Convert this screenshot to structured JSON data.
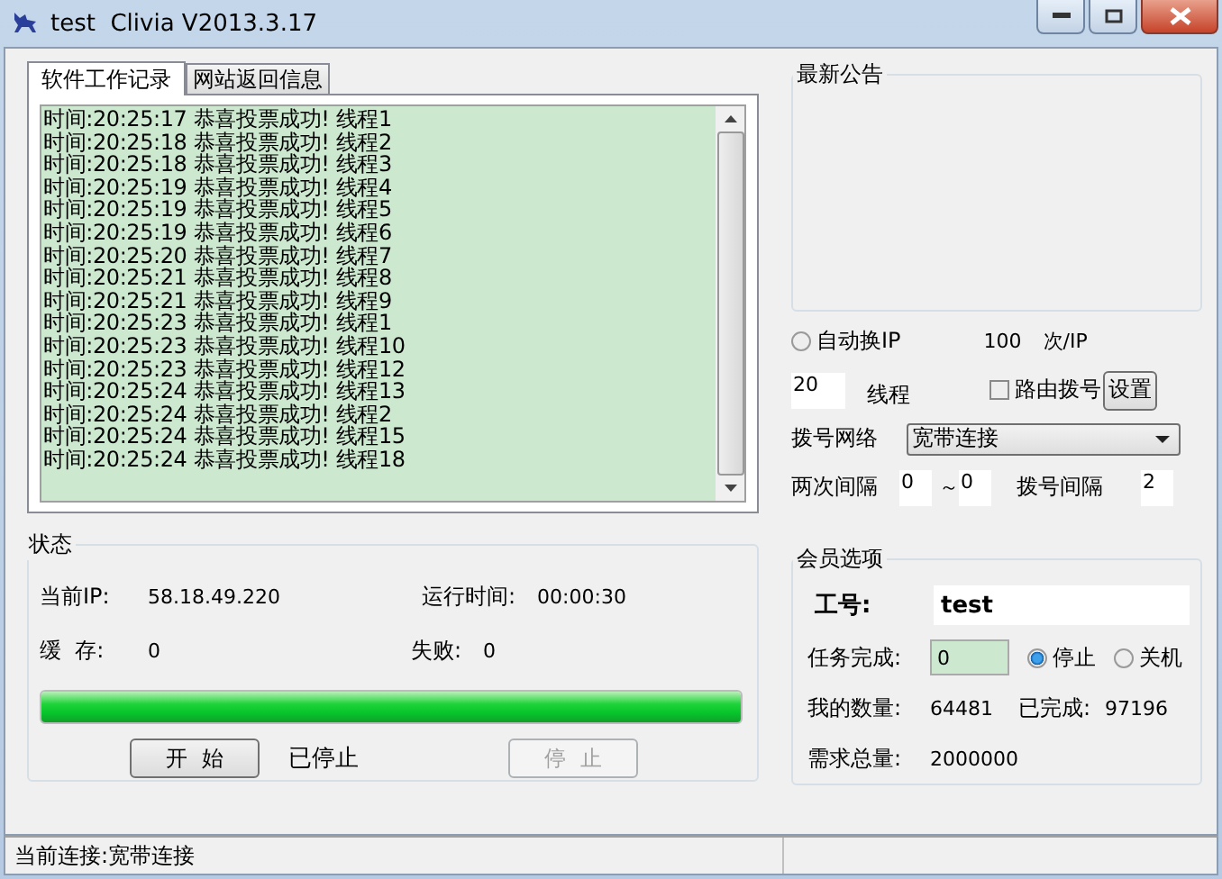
{
  "window": {
    "title": "test  Clivia V2013.3.17"
  },
  "tabs": [
    {
      "label": "软件工作记录",
      "selected": true
    },
    {
      "label": "网站返回信息",
      "selected": false
    }
  ],
  "log": [
    "时间:20:25:17 恭喜投票成功! 线程1",
    "时间:20:25:18 恭喜投票成功! 线程2",
    "时间:20:25:18 恭喜投票成功! 线程3",
    "时间:20:25:19 恭喜投票成功! 线程4",
    "时间:20:25:19 恭喜投票成功! 线程5",
    "时间:20:25:19 恭喜投票成功! 线程6",
    "时间:20:25:20 恭喜投票成功! 线程7",
    "时间:20:25:21 恭喜投票成功! 线程8",
    "时间:20:25:21 恭喜投票成功! 线程9",
    "时间:20:25:23 恭喜投票成功! 线程1",
    "时间:20:25:23 恭喜投票成功! 线程10",
    "时间:20:25:23 恭喜投票成功! 线程12",
    "时间:20:25:24 恭喜投票成功! 线程13",
    "时间:20:25:24 恭喜投票成功! 线程2",
    "时间:20:25:24 恭喜投票成功! 线程15",
    "时间:20:25:24 恭喜投票成功! 线程18"
  ],
  "status": {
    "title": "状态",
    "ip_label": "当前IP:",
    "ip": "58.18.49.220",
    "runtime_label": "运行时间:",
    "runtime": "00:00:30",
    "cache_label": "缓  存:",
    "cache": "0",
    "fail_label": "失败:",
    "fail": "0",
    "progress": {
      "level": 1
    },
    "start": {
      "label": "开  始",
      "disabled": false
    },
    "state": "已停止",
    "stop": {
      "label": "停  止",
      "disabled": true
    }
  },
  "notice": {
    "title": "最新公告"
  },
  "settings": {
    "auto_ip": {
      "label": "自动换IP",
      "selected": false
    },
    "per_ip": "100",
    "per_ip_unit": "次/IP",
    "threads": "20",
    "threads_label": "线程",
    "router_dial": {
      "label": "路由拨号",
      "checked": false
    },
    "setup_button": "设置",
    "network_label": "拨号网络",
    "network": "宽带连接",
    "interval_label": "两次间隔",
    "interval_from": "0",
    "tilde": "～",
    "interval_to": "0",
    "dial_interval_label": "拨号间隔",
    "dial_interval": "2"
  },
  "member": {
    "title": "会员选项",
    "id_label": "工号:",
    "id": "test",
    "task_label": "任务完成:",
    "task": "0",
    "task_options": [
      {
        "label": "停止",
        "selected": true
      },
      {
        "label": "关机",
        "selected": false
      }
    ],
    "my_count_label": "我的数量:",
    "my_count": "64481",
    "done_label": "已完成:",
    "done": "97196",
    "total_label": "需求总量:",
    "total": "2000000"
  },
  "status_bar": "当前连接:宽带连接"
}
